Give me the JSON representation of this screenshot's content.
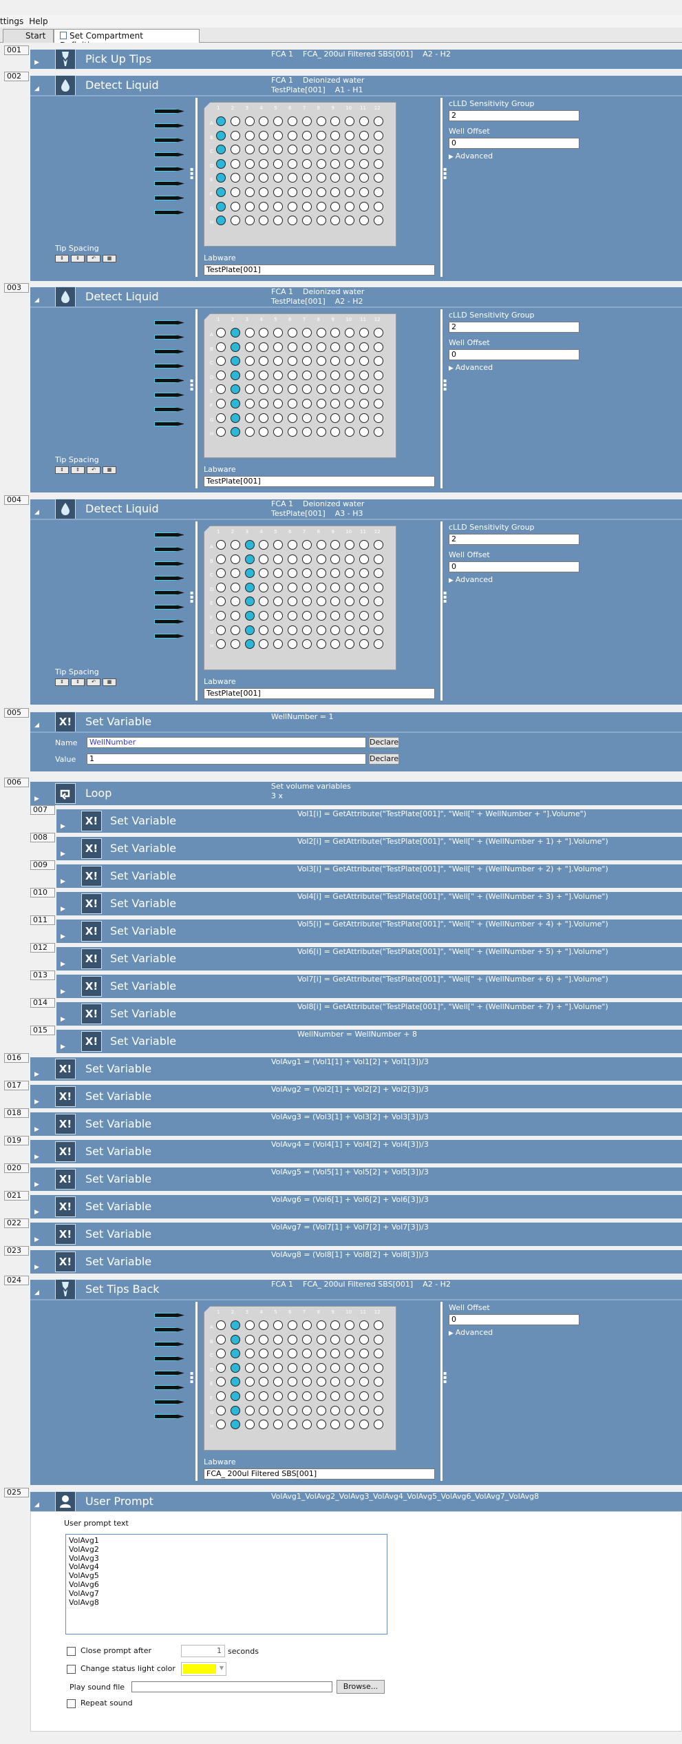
{
  "menu": [
    "ttings",
    "Help"
  ],
  "tabs": [
    {
      "label": "Start"
    },
    {
      "label": "Set Compartment Definitions"
    }
  ],
  "colors": {
    "accent": "#6a8fb6",
    "tip_glow": "#49d1e8",
    "well_on": "#2bb7d8",
    "status_yellow": "#ffff00"
  },
  "plate_cols": [
    "1",
    "2",
    "3",
    "4",
    "5",
    "6",
    "7",
    "8",
    "9",
    "10",
    "11",
    "12"
  ],
  "plate_rows": [
    "A",
    "B",
    "C",
    "D",
    "E",
    "F",
    "G",
    "H"
  ],
  "steps": [
    {
      "num": "001",
      "title": "Pick Up Tips",
      "icon": "tip-down-icon",
      "detail": "FCA 1    FCA_ 200ul Filtered SBS[001]    A2 - H2"
    },
    {
      "num": "002",
      "title": "Detect Liquid",
      "icon": "droplet-icon",
      "detail": "FCA 1    Deionized water\nTestPlate[001]    A1 - H1",
      "labware_label": "Labware",
      "labware": "TestPlate[001]",
      "tip_spacing": "Tip Spacing",
      "sensitivity_label": "cLLD Sensitivity Group",
      "sensitivity": "2",
      "offset_label": "Well Offset",
      "offset": "0",
      "advanced": "Advanced",
      "active_col": 0
    },
    {
      "num": "003",
      "title": "Detect Liquid",
      "icon": "droplet-icon",
      "detail": "FCA 1    Deionized water\nTestPlate[001]    A2 - H2",
      "labware_label": "Labware",
      "labware": "TestPlate[001]",
      "tip_spacing": "Tip Spacing",
      "sensitivity_label": "cLLD Sensitivity Group",
      "sensitivity": "2",
      "offset_label": "Well Offset",
      "offset": "0",
      "advanced": "Advanced",
      "active_col": 1
    },
    {
      "num": "004",
      "title": "Detect Liquid",
      "icon": "droplet-icon",
      "detail": "FCA 1    Deionized water\nTestPlate[001]    A3 - H3",
      "labware_label": "Labware",
      "labware": "TestPlate[001]",
      "tip_spacing": "Tip Spacing",
      "sensitivity_label": "cLLD Sensitivity Group",
      "sensitivity": "2",
      "offset_label": "Well Offset",
      "offset": "0",
      "advanced": "Advanced",
      "active_col": 2
    },
    {
      "num": "005",
      "title": "Set Variable",
      "icon": "set-variable-icon",
      "detail": "WellNumber = 1",
      "name_label": "Name",
      "name_value": "WellNumber",
      "value_label": "Value",
      "value_value": "1",
      "declare": "Declare"
    },
    {
      "num": "006",
      "title": "Loop",
      "icon": "loop-icon",
      "detail": "Set volume variables\n3 x"
    },
    {
      "num": "007",
      "title": "Set Variable",
      "detail": "Vol1[i] = GetAttribute(\"TestPlate[001]\", \"Well[\" + WellNumber + \"].Volume\")"
    },
    {
      "num": "008",
      "title": "Set Variable",
      "detail": "Vol2[i] = GetAttribute(\"TestPlate[001]\", \"Well[\" + (WellNumber + 1) + \"].Volume\")"
    },
    {
      "num": "009",
      "title": "Set Variable",
      "detail": "Vol3[i] = GetAttribute(\"TestPlate[001]\", \"Well[\" + (WellNumber + 2) + \"].Volume\")"
    },
    {
      "num": "010",
      "title": "Set Variable",
      "detail": "Vol4[i] = GetAttribute(\"TestPlate[001]\", \"Well[\" + (WellNumber + 3) + \"].Volume\")"
    },
    {
      "num": "011",
      "title": "Set Variable",
      "detail": "Vol5[i] = GetAttribute(\"TestPlate[001]\", \"Well[\" + (WellNumber + 4) + \"].Volume\")"
    },
    {
      "num": "012",
      "title": "Set Variable",
      "detail": "Vol6[i] = GetAttribute(\"TestPlate[001]\", \"Well[\" + (WellNumber + 5) + \"].Volume\")"
    },
    {
      "num": "013",
      "title": "Set Variable",
      "detail": "Vol7[i] = GetAttribute(\"TestPlate[001]\", \"Well[\" + (WellNumber + 6) + \"].Volume\")"
    },
    {
      "num": "014",
      "title": "Set Variable",
      "detail": "Vol8[i] = GetAttribute(\"TestPlate[001]\", \"Well[\" + (WellNumber + 7) + \"].Volume\")"
    },
    {
      "num": "015",
      "title": "Set Variable",
      "detail": "WellNumber = WellNumber + 8"
    },
    {
      "num": "016",
      "title": "Set Variable",
      "detail": "VolAvg1 = (Vol1[1] + Vol1[2] + Vol1[3])/3"
    },
    {
      "num": "017",
      "title": "Set Variable",
      "detail": "VolAvg2 = (Vol2[1] + Vol2[2] + Vol2[3])/3"
    },
    {
      "num": "018",
      "title": "Set Variable",
      "detail": "VolAvg3 = (Vol3[1] + Vol3[2] + Vol3[3])/3"
    },
    {
      "num": "019",
      "title": "Set Variable",
      "detail": "VolAvg4 = (Vol4[1] + Vol4[2] + Vol4[3])/3"
    },
    {
      "num": "020",
      "title": "Set Variable",
      "detail": "VolAvg5 = (Vol5[1] + Vol5[2] + Vol5[3])/3"
    },
    {
      "num": "021",
      "title": "Set Variable",
      "detail": "VolAvg6 = (Vol6[1] + Vol6[2] + Vol6[3])/3"
    },
    {
      "num": "022",
      "title": "Set Variable",
      "detail": "VolAvg7 = (Vol7[1] + Vol7[2] + Vol7[3])/3"
    },
    {
      "num": "023",
      "title": "Set Variable",
      "detail": "VolAvg8 = (Vol8[1] + Vol8[2] + Vol8[3])/3"
    },
    {
      "num": "024",
      "title": "Set Tips Back",
      "icon": "tip-down-icon",
      "detail": "FCA 1    FCA_ 200ul Filtered SBS[001]    A2 - H2",
      "labware_label": "Labware",
      "labware": "FCA_ 200ul Filtered SBS[001]",
      "offset_label": "Well Offset",
      "offset": "0",
      "advanced": "Advanced",
      "active_col": 1
    },
    {
      "num": "025",
      "title": "User Prompt",
      "icon": "user-icon",
      "detail": "VolAvg1_VolAvg2_VolAvg3_VolAvg4_VolAvg5_VolAvg6_VolAvg7_VolAvg8",
      "prompt_label": "User prompt text",
      "prompt_text": "VolAvg1\nVolAvg2\nVolAvg3\nVolAvg4\nVolAvg5\nVolAvg6\nVolAvg7\nVolAvg8",
      "close_label": "Close prompt after",
      "close_value": "1",
      "seconds": "seconds",
      "status_label": "Change status light color",
      "sound_label": "Play sound file",
      "sound_value": "",
      "browse": "Browse...",
      "repeat_label": "Repeat sound"
    }
  ]
}
